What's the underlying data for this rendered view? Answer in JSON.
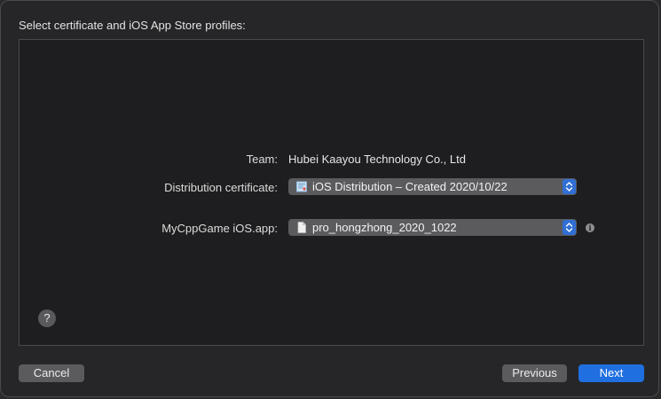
{
  "dialog": {
    "heading": "Select certificate and iOS App Store profiles:"
  },
  "form": {
    "team_label": "Team:",
    "team_value": "Hubei Kaayou Technology Co., Ltd",
    "certificate_label": "Distribution certificate:",
    "certificate_value": "iOS Distribution – Created 2020/10/22",
    "certificate_icon": "certificate-icon",
    "profile_label": "MyCppGame iOS.app:",
    "profile_value": "pro_hongzhong_2020_1022",
    "profile_icon": "document-icon",
    "info_icon_glyph": "i"
  },
  "help": {
    "glyph": "?"
  },
  "buttons": {
    "cancel": "Cancel",
    "previous": "Previous",
    "next": "Next"
  },
  "colors": {
    "accent": "#1f6fe0",
    "stepper": "#2f6fd6",
    "popup_bg": "#5b5b5e",
    "panel_bg": "#1e1e20"
  }
}
